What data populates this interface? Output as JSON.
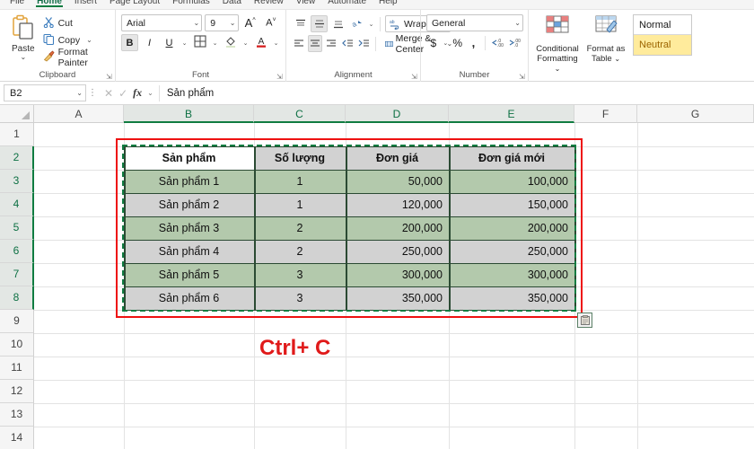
{
  "tabs": {
    "items": [
      {
        "label": "File",
        "active": false
      },
      {
        "label": "Home",
        "active": true
      },
      {
        "label": "Insert",
        "active": false
      },
      {
        "label": "Page Layout",
        "active": false
      },
      {
        "label": "Formulas",
        "active": false
      },
      {
        "label": "Data",
        "active": false
      },
      {
        "label": "Review",
        "active": false
      },
      {
        "label": "View",
        "active": false
      },
      {
        "label": "Automate",
        "active": false
      },
      {
        "label": "Help",
        "active": false
      }
    ]
  },
  "ribbon": {
    "clipboard": {
      "group_label": "Clipboard",
      "paste_label": "Paste",
      "cut_label": "Cut",
      "copy_label": "Copy",
      "format_painter_label": "Format Painter"
    },
    "font": {
      "group_label": "Font",
      "font_name": "Arial",
      "font_size": "9",
      "grow_font": "A",
      "shrink_font": "A",
      "bold": "B",
      "italic": "I",
      "underline": "U"
    },
    "alignment": {
      "group_label": "Alignment",
      "wrap_text_label": "Wrap Text",
      "merge_center_label": "Merge & Center"
    },
    "number": {
      "group_label": "Number",
      "format": "General",
      "currency": "$",
      "percent": "%",
      "comma": "'"
    },
    "styles": {
      "conditional_formatting_label": "Conditional\nFormatting",
      "conditional_formatting_line1": "Conditional",
      "conditional_formatting_line2": "Formatting",
      "format_as_table_line1": "Format as",
      "format_as_table_line2": "Table",
      "cell_style_normal": "Normal",
      "cell_style_neutral": "Neutral"
    }
  },
  "formula_bar": {
    "name_box": "B2",
    "formula_value": "Sản phẩm",
    "cancel_icon": "✕",
    "enter_icon": "✓",
    "function_icon": "fx"
  },
  "sheet": {
    "column_headers": [
      "A",
      "B",
      "C",
      "D",
      "E",
      "F",
      "G"
    ],
    "selected_columns": [
      "B",
      "C",
      "D",
      "E"
    ],
    "row_headers": [
      "1",
      "2",
      "3",
      "4",
      "5",
      "6",
      "7",
      "8",
      "9",
      "10",
      "11",
      "12",
      "13",
      "14"
    ],
    "selected_rows": [
      "2",
      "3",
      "4",
      "5",
      "6",
      "7",
      "8"
    ],
    "table": {
      "headers": [
        "Sản phẩm",
        "Số lượng",
        "Đơn giá",
        "Đơn giá mới"
      ],
      "rows": [
        [
          "Sản phẩm 1",
          "1",
          "50,000",
          "100,000"
        ],
        [
          "Sản phẩm 2",
          "1",
          "120,000",
          "150,000"
        ],
        [
          "Sản phẩm 3",
          "2",
          "200,000",
          "200,000"
        ],
        [
          "Sản phẩm 4",
          "2",
          "250,000",
          "250,000"
        ],
        [
          "Sản phẩm 5",
          "3",
          "300,000",
          "300,000"
        ],
        [
          "Sản phẩm 6",
          "3",
          "350,000",
          "350,000"
        ]
      ],
      "row_fills": [
        "green",
        "gray",
        "green",
        "gray",
        "green",
        "gray"
      ],
      "header_fill": "gray",
      "active_cell_fill": "white"
    }
  },
  "annotation": {
    "shortcut_text": "Ctrl+ C",
    "shortcut_color": "#e01a1a",
    "highlight_box_color": "#ee1111"
  },
  "colors": {
    "excel_green": "#107c41",
    "selection_green": "#b3c9ac",
    "selection_gray": "#d2d2d2",
    "marquee_green": "#107c41",
    "neutral_bg": "#ffeb9c",
    "neutral_fg": "#9c6500"
  }
}
